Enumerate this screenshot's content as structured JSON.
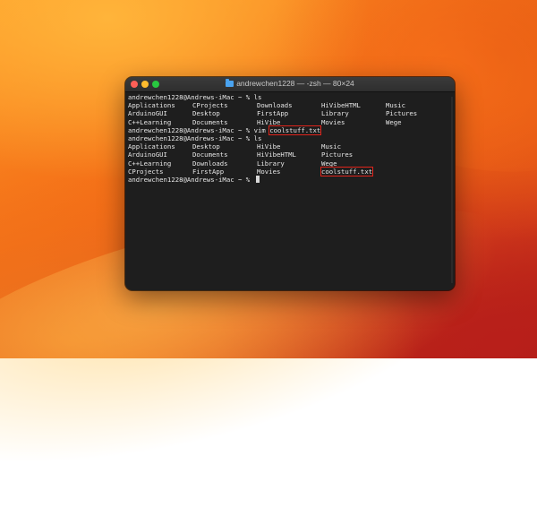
{
  "window": {
    "title": "andrewchen1228 — -zsh — 80×24"
  },
  "terminal": {
    "prompt": "andrewchen1228@Andrews-iMac ~ %",
    "lines": [
      {
        "type": "cmd",
        "command": "ls"
      },
      {
        "type": "cols",
        "cells": [
          "Applications",
          "CProjects",
          "Downloads",
          "HiVibeHTML",
          "Music"
        ]
      },
      {
        "type": "cols",
        "cells": [
          "ArduinoGUI",
          "Desktop",
          "FirstApp",
          "Library",
          "Pictures"
        ]
      },
      {
        "type": "cols",
        "cells": [
          "C++Learning",
          "Documents",
          "HiVibe",
          "Movies",
          "Wege"
        ]
      },
      {
        "type": "cmd",
        "command": "vim",
        "arg": "coolstuff.txt"
      },
      {
        "type": "cmd",
        "command": "ls"
      },
      {
        "type": "cols",
        "cells": [
          "Applications",
          "Desktop",
          "HiVibe",
          "Music",
          ""
        ]
      },
      {
        "type": "cols",
        "cells": [
          "ArduinoGUI",
          "Documents",
          "HiVibeHTML",
          "Pictures",
          ""
        ]
      },
      {
        "type": "cols",
        "cells": [
          "C++Learning",
          "Downloads",
          "Library",
          "Wege",
          ""
        ]
      },
      {
        "type": "cols",
        "cells": [
          "CProjects",
          "FirstApp",
          "Movies",
          "coolstuff.txt",
          ""
        ],
        "highlight_col": 3
      },
      {
        "type": "prompt"
      }
    ]
  },
  "colors": {
    "highlight": "#e0241b",
    "terminal_bg": "#1e1e1e",
    "text": "#e6e6e6"
  }
}
